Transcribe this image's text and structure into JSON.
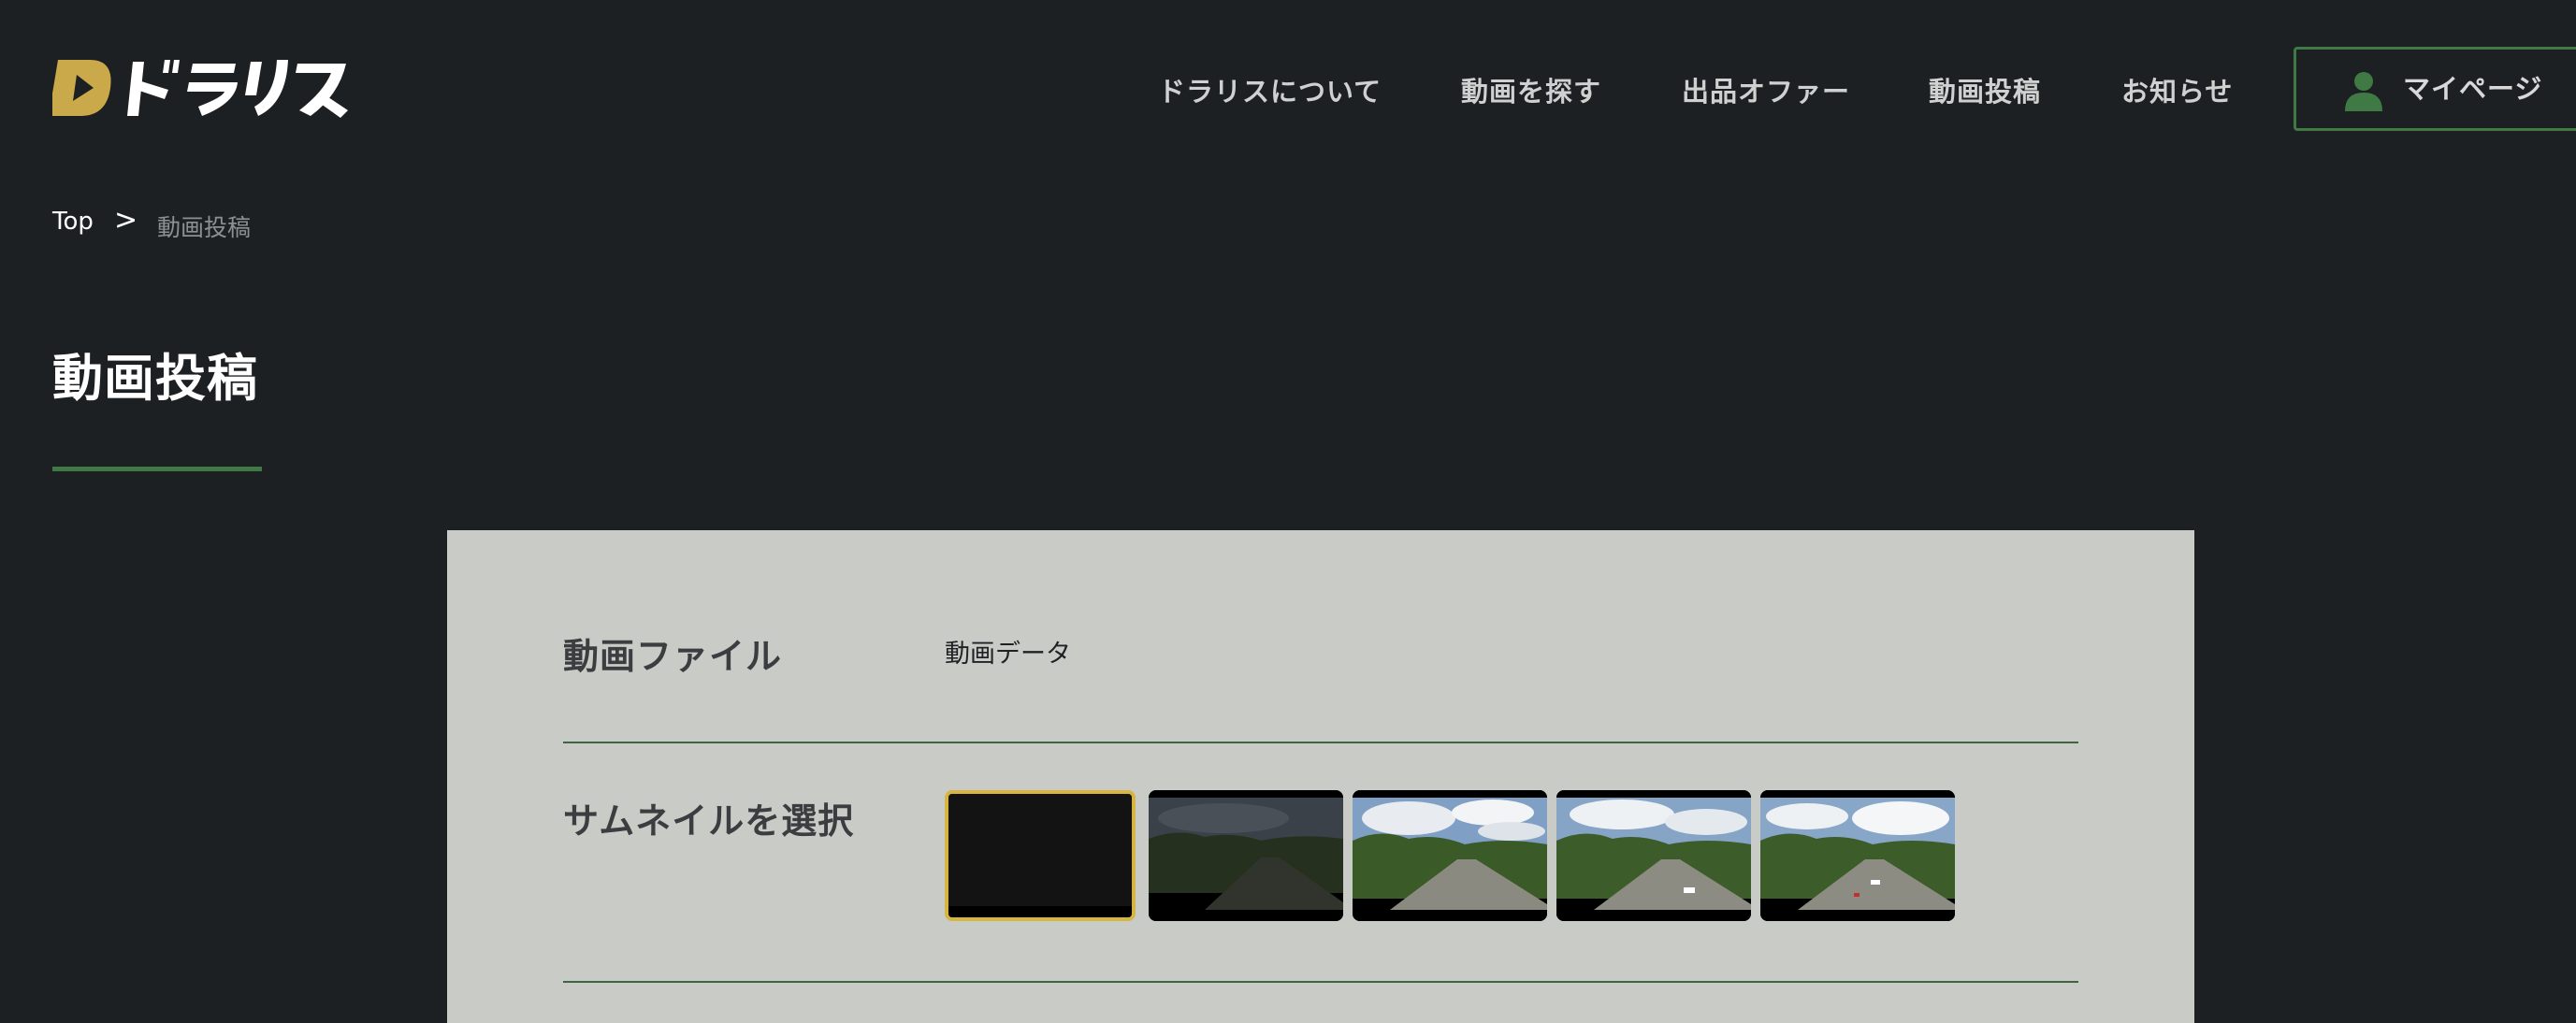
{
  "brand": {
    "logo_text": "ドラリス",
    "logo_mark": "D",
    "logo_color": "#c9a94a"
  },
  "nav": {
    "items": [
      {
        "label": "ドラリスについて"
      },
      {
        "label": "動画を探す"
      },
      {
        "label": "出品オファー"
      },
      {
        "label": "動画投稿"
      },
      {
        "label": "お知らせ"
      }
    ],
    "mypage": {
      "label": "マイページ",
      "icon": "person-icon"
    }
  },
  "breadcrumb": {
    "top": "Top",
    "separator": ">",
    "current": "動画投稿"
  },
  "page": {
    "title": "動画投稿"
  },
  "form": {
    "video_file": {
      "label": "動画ファイル",
      "value": "動画データ"
    },
    "thumbnail": {
      "label": "サムネイルを選択",
      "options": [
        {
          "kind": "black",
          "selected": true
        },
        {
          "kind": "dusk",
          "selected": false
        },
        {
          "kind": "day",
          "selected": false
        },
        {
          "kind": "day",
          "selected": false
        },
        {
          "kind": "day",
          "selected": false
        }
      ]
    }
  },
  "colors": {
    "background": "#1d2022",
    "accent_green": "#3f7a44",
    "selected_border": "#d8b440",
    "panel": "#c9cbc7"
  }
}
